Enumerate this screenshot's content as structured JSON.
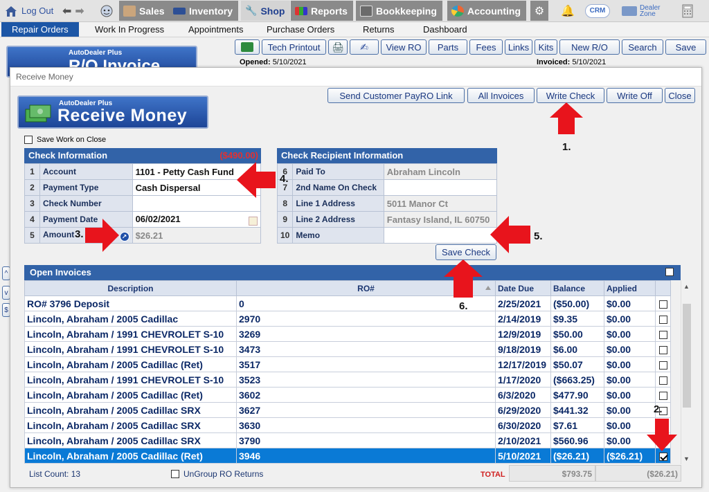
{
  "topbar": {
    "logout": "Log Out",
    "tabs": [
      "Sales",
      "Inventory",
      "Shop",
      "Reports",
      "Bookkeeping",
      "Accounting"
    ],
    "active_tab": "Shop",
    "crm": "CRM",
    "dealer_zone_1": "Dealer",
    "dealer_zone_2": "Zone"
  },
  "nav": {
    "items": [
      "Repair Orders",
      "Work In Progress",
      "Appointments",
      "Purchase Orders",
      "Returns",
      "Dashboard"
    ],
    "active": "Repair Orders"
  },
  "background_window": {
    "logo_brand": "AutoDealer Plus",
    "logo_title": "R/O Invoice",
    "buttons": [
      "Tech Printout",
      "View RO",
      "Parts",
      "Fees",
      "Links",
      "Kits",
      "New R/O",
      "Search",
      "Save"
    ],
    "opened_label": "Opened:",
    "opened_value": "5/10/2021",
    "invoiced_label": "Invoiced:",
    "invoiced_value": "5/10/2021",
    "side_buttons": [
      "^",
      "v",
      "$"
    ]
  },
  "modal": {
    "title": "Receive Money",
    "logo_brand": "AutoDealer Plus",
    "logo_title": "Receive Money",
    "buttons": {
      "send_payro": "Send Customer PayRO Link",
      "all_invoices": "All Invoices",
      "write_check": "Write Check",
      "write_off": "Write Off",
      "close": "Close"
    },
    "save_work_on_close": "Save Work on Close",
    "check_info": {
      "header": "Check Information",
      "total": "($490.00)",
      "rows": [
        {
          "num": "1",
          "label": "Account",
          "value": "1101 - Petty Cash Fund"
        },
        {
          "num": "2",
          "label": "Payment Type",
          "value": "Cash Dispersal"
        },
        {
          "num": "3",
          "label": "Check Number",
          "value": ""
        },
        {
          "num": "4",
          "label": "Payment Date",
          "value": "06/02/2021"
        },
        {
          "num": "5",
          "label": "Amount",
          "value": "$26.21"
        }
      ]
    },
    "recipient_info": {
      "header": "Check Recipient Information",
      "rows": [
        {
          "num": "6",
          "label": "Paid To",
          "value": "Abraham Lincoln"
        },
        {
          "num": "7",
          "label": "2nd Name On Check",
          "value": ""
        },
        {
          "num": "8",
          "label": "Line 1 Address",
          "value": "5011 Manor Ct"
        },
        {
          "num": "9",
          "label": "Line 2 Address",
          "value": "Fantasy Island, IL 60750"
        },
        {
          "num": "10",
          "label": "Memo",
          "value": ""
        }
      ]
    },
    "save_check": "Save Check",
    "open_invoices": {
      "header": "Open Invoices",
      "columns": [
        "Description",
        "RO#",
        "Date Due",
        "Balance",
        "Applied"
      ],
      "rows": [
        {
          "desc": "RO# 3796 Deposit",
          "ro": "0",
          "due": "2/25/2021",
          "balance": "($50.00)",
          "applied": "$0.00",
          "checked": false
        },
        {
          "desc": "Lincoln, Abraham / 2005 Cadillac",
          "ro": "2970",
          "due": "2/14/2019",
          "balance": "$9.35",
          "applied": "$0.00",
          "checked": false
        },
        {
          "desc": "Lincoln, Abraham / 1991 CHEVROLET S-10",
          "ro": "3269",
          "due": "12/9/2019",
          "balance": "$50.00",
          "applied": "$0.00",
          "checked": false
        },
        {
          "desc": "Lincoln, Abraham / 1991 CHEVROLET S-10",
          "ro": "3473",
          "due": "9/18/2019",
          "balance": "$6.00",
          "applied": "$0.00",
          "checked": false
        },
        {
          "desc": "Lincoln, Abraham / 2005 Cadillac  (Ret)",
          "ro": "3517",
          "due": "12/17/2019",
          "balance": "$50.07",
          "applied": "$0.00",
          "checked": false
        },
        {
          "desc": "Lincoln, Abraham / 1991 CHEVROLET S-10",
          "ro": "3523",
          "due": "1/17/2020",
          "balance": "($663.25)",
          "applied": "$0.00",
          "checked": false
        },
        {
          "desc": "Lincoln, Abraham / 2005 Cadillac  (Ret)",
          "ro": "3602",
          "due": "6/3/2020",
          "balance": "$477.90",
          "applied": "$0.00",
          "checked": false
        },
        {
          "desc": "Lincoln, Abraham / 2005 Cadillac SRX",
          "ro": "3627",
          "due": "6/29/2020",
          "balance": "$441.32",
          "applied": "$0.00",
          "checked": false
        },
        {
          "desc": "Lincoln, Abraham / 2005 Cadillac SRX",
          "ro": "3630",
          "due": "6/30/2020",
          "balance": "$7.61",
          "applied": "$0.00",
          "checked": false
        },
        {
          "desc": "Lincoln, Abraham / 2005 Cadillac SRX",
          "ro": "3790",
          "due": "2/10/2021",
          "balance": "$560.96",
          "applied": "$0.00",
          "checked": false
        },
        {
          "desc": "Lincoln, Abraham / 2005 Cadillac  (Ret)",
          "ro": "3946",
          "due": "5/10/2021",
          "balance": "($26.21)",
          "applied": "($26.21)",
          "checked": true
        }
      ]
    },
    "list_count": "List Count: 13",
    "ungroup": "UnGroup RO Returns",
    "total_label": "TOTAL",
    "total_balance": "$793.75",
    "total_applied": "($26.21)"
  },
  "annotations": [
    "1.",
    "2.",
    "3.",
    "4.",
    "5.",
    "6."
  ],
  "colors": {
    "accent": "#3263a8",
    "selected": "#0a7ad6",
    "arrow": "#e8141c",
    "total_red": "#d01f1f"
  }
}
